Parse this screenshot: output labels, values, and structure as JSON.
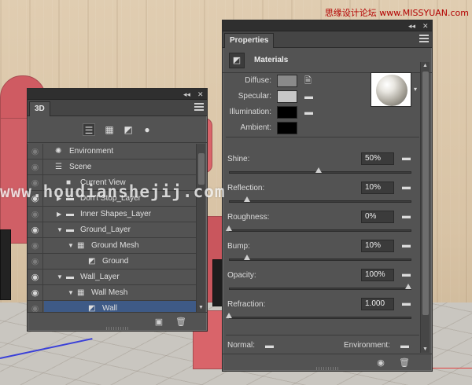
{
  "watermarks": {
    "top_right": "思缘设计论坛 www.MISSYUAN.com",
    "middle": "www.houdianshejij.com"
  },
  "panel_3d": {
    "tab": "3D",
    "filters": [
      {
        "icon": "scene-icon",
        "glyph": "☰"
      },
      {
        "icon": "mesh-icon",
        "glyph": "▦"
      },
      {
        "icon": "materials-icon",
        "glyph": "◩"
      },
      {
        "icon": "light-icon",
        "glyph": "●"
      }
    ],
    "layers": [
      {
        "name": "Environment",
        "icon": "environment-icon",
        "glyph": "✺",
        "indent": 0,
        "twisty": "",
        "eye": false,
        "selected": false
      },
      {
        "name": "Scene",
        "icon": "scene-icon",
        "glyph": "☰",
        "indent": 0,
        "twisty": "",
        "eye": false,
        "selected": false
      },
      {
        "name": "Current View",
        "icon": "camera-icon",
        "glyph": "■",
        "indent": 1,
        "twisty": "",
        "eye": false,
        "selected": false
      },
      {
        "name": "Don't Stop_Layer",
        "icon": "folder-icon",
        "glyph": "▬",
        "indent": 1,
        "twisty": "▶",
        "eye": true,
        "selected": false
      },
      {
        "name": "Inner Shapes_Layer",
        "icon": "folder-icon",
        "glyph": "▬",
        "indent": 1,
        "twisty": "▶",
        "eye": false,
        "selected": false
      },
      {
        "name": "Ground_Layer",
        "icon": "folder-icon",
        "glyph": "▬",
        "indent": 1,
        "twisty": "▼",
        "eye": true,
        "selected": false
      },
      {
        "name": "Ground Mesh",
        "icon": "mesh-icon",
        "glyph": "▦",
        "indent": 2,
        "twisty": "▼",
        "eye": false,
        "selected": false
      },
      {
        "name": "Ground",
        "icon": "material-icon",
        "glyph": "◩",
        "indent": 3,
        "twisty": "",
        "eye": false,
        "selected": false
      },
      {
        "name": "Wall_Layer",
        "icon": "folder-icon",
        "glyph": "▬",
        "indent": 1,
        "twisty": "▼",
        "eye": true,
        "selected": false
      },
      {
        "name": "Wall Mesh",
        "icon": "mesh-icon",
        "glyph": "▦",
        "indent": 2,
        "twisty": "▼",
        "eye": true,
        "selected": false
      },
      {
        "name": "Wall",
        "icon": "material-icon",
        "glyph": "◩",
        "indent": 3,
        "twisty": "",
        "eye": false,
        "selected": true
      }
    ]
  },
  "properties": {
    "tab": "Properties",
    "section_title": "Materials",
    "colors": [
      {
        "label": "Diffuse:",
        "color": "#8a8a8a",
        "has_folder": true,
        "folder_glyph": "🗎"
      },
      {
        "label": "Specular:",
        "color": "#c7c7c7",
        "has_folder": true,
        "folder_glyph": "▬"
      },
      {
        "label": "Illumination:",
        "color": "#000000",
        "has_folder": true,
        "folder_glyph": "▬"
      },
      {
        "label": "Ambient:",
        "color": "#000000",
        "has_folder": false,
        "folder_glyph": ""
      }
    ],
    "sliders": [
      {
        "label": "Shine:",
        "value": "50%",
        "fraction": 0.5
      },
      {
        "label": "Reflection:",
        "value": "10%",
        "fraction": 0.1
      },
      {
        "label": "Roughness:",
        "value": "0%",
        "fraction": 0.0
      },
      {
        "label": "Bump:",
        "value": "10%",
        "fraction": 0.1
      },
      {
        "label": "Opacity:",
        "value": "100%",
        "fraction": 1.0
      },
      {
        "label": "Refraction:",
        "value": "1.000",
        "fraction": 0.0
      }
    ],
    "normal_label": "Normal:",
    "environment_label": "Environment:"
  }
}
